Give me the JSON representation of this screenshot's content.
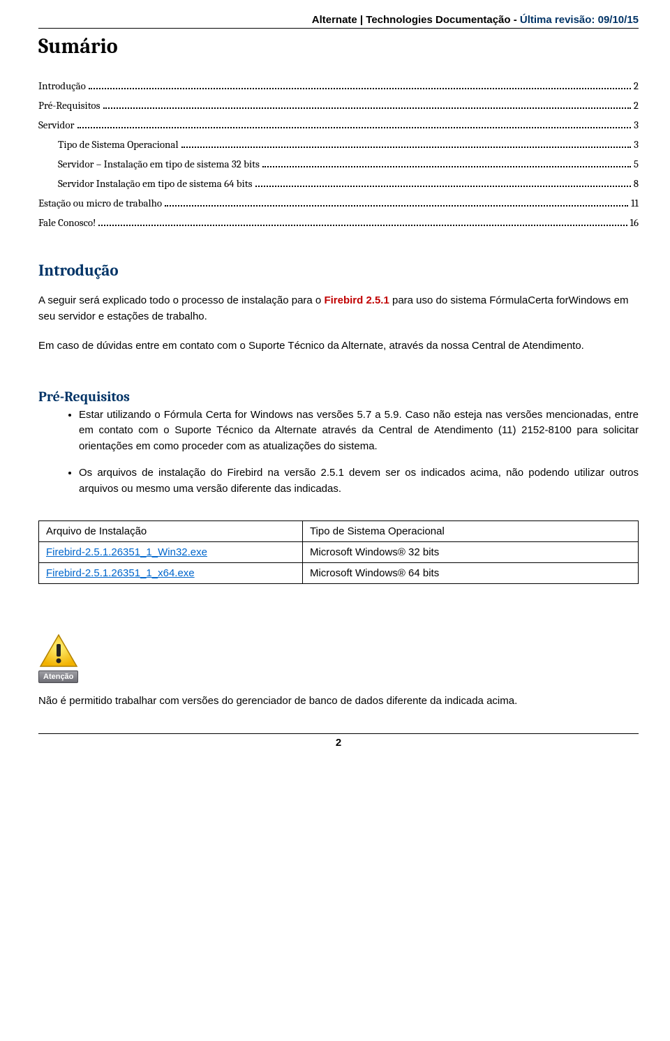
{
  "header": {
    "brand": "Alternate | Technologies",
    "section": " Documentação - ",
    "revision_label": "Última revisão: ",
    "revision_date": "09/10/15"
  },
  "sumario": {
    "title": "Sumário",
    "items": [
      {
        "label": "Introdução",
        "page": "2",
        "indent": 0
      },
      {
        "label": "Pré-Requisitos",
        "page": "2",
        "indent": 0
      },
      {
        "label": "Servidor",
        "page": "3",
        "indent": 0
      },
      {
        "label": "Tipo de Sistema Operacional",
        "page": "3",
        "indent": 1
      },
      {
        "label": "Servidor – Instalação em tipo de sistema 32 bits",
        "page": "5",
        "indent": 1
      },
      {
        "label": "Servidor Instalação em tipo de sistema 64 bits",
        "page": "8",
        "indent": 1
      },
      {
        "label": "Estação ou micro de trabalho",
        "page": "11",
        "indent": 0
      },
      {
        "label": "Fale Conosco!",
        "page": "16",
        "indent": 0
      }
    ]
  },
  "introducao": {
    "title": "Introdução",
    "p1_pre": "A seguir será explicado todo o processo de instalação para o ",
    "p1_firebird": "Firebird 2.5.1",
    "p1_post": " para uso do sistema FórmulaCerta forWindows em seu servidor e estações de trabalho.",
    "p2": "Em caso de dúvidas entre em contato com o Suporte Técnico da Alternate, através da nossa Central de Atendimento."
  },
  "prereq": {
    "title": "Pré-Requisitos",
    "item1": "Estar utilizando o Fórmula Certa for Windows nas versões 5.7 a 5.9. Caso não esteja nas versões mencionadas, entre em contato com o Suporte Técnico da Alternate através da Central de Atendimento (11) 2152-8100 para solicitar orientações em como proceder com as atualizações do sistema.",
    "item2": "Os arquivos de instalação do Firebird na versão 2.5.1 devem ser os indicados acima, não podendo utilizar outros arquivos ou mesmo uma versão diferente das indicadas."
  },
  "table": {
    "header_left": "Arquivo de Instalação",
    "header_right": "Tipo de Sistema Operacional",
    "rows": [
      {
        "file": "Firebird-2.5.1.26351_1_Win32.exe",
        "os": "Microsoft Windows® 32 bits"
      },
      {
        "file": "Firebird-2.5.1.26351_1_x64.exe",
        "os": "Microsoft Windows® 64 bits"
      }
    ]
  },
  "warning": {
    "label": "Atenção",
    "text": "Não é permitido trabalhar com versões do gerenciador de banco de dados diferente da indicada acima."
  },
  "footer": {
    "page_number": "2"
  }
}
